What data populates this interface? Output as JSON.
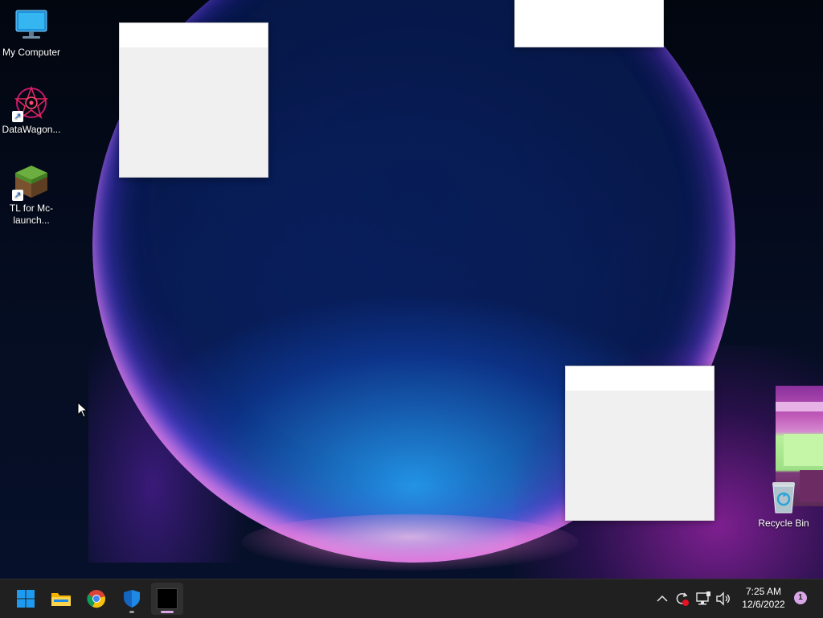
{
  "desktop": {
    "icons": [
      {
        "label": "My Computer",
        "icon": "monitor-icon"
      },
      {
        "label": "DataWagon...",
        "icon": "datawagon-app-icon",
        "shortcut": true
      },
      {
        "label": "TL for Mc-launch...",
        "icon": "minecraft-grass-block-icon",
        "shortcut": true
      },
      {
        "label": "Recycle Bin",
        "icon": "recycle-bin-icon"
      }
    ]
  },
  "taskbar": {
    "pinned": [
      {
        "name": "Start",
        "icon": "windows-start-icon"
      },
      {
        "name": "File Explorer",
        "icon": "folder-icon"
      },
      {
        "name": "Google Chrome",
        "icon": "chrome-icon"
      },
      {
        "name": "Windows Security",
        "icon": "shield-icon"
      },
      {
        "name": "Terminal",
        "icon": "black-window-icon",
        "active": true
      }
    ],
    "tray": {
      "icons": [
        "chevron-up-icon",
        "sync-icon",
        "network-icon",
        "speaker-icon"
      ],
      "time": "7:25 AM",
      "date": "12/6/2022",
      "notification_count": "1"
    }
  },
  "colors": {
    "taskbar": "#202020",
    "accent": "#0078d4",
    "active_indicator": "#d9a7e8"
  }
}
